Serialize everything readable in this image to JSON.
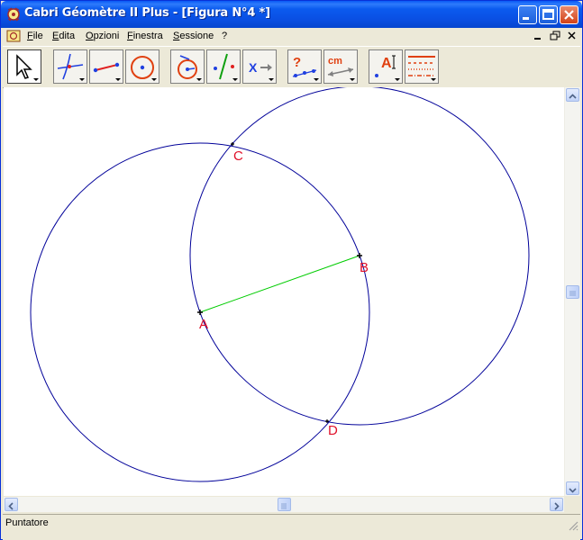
{
  "window": {
    "title": "Cabri Géomètre II Plus - [Figura N°4 *]"
  },
  "menubar": {
    "items": [
      "File",
      "Edita",
      "Opzioni",
      "Finestra",
      "Sessione",
      "?"
    ]
  },
  "toolbar": {
    "tools": [
      {
        "name": "pointer-tool",
        "active": true
      },
      {
        "name": "lines-tool"
      },
      {
        "name": "segment-tool"
      },
      {
        "name": "circle-tool"
      },
      {
        "name": "construction-tool"
      },
      {
        "name": "perpendicular-tool"
      },
      {
        "name": "transformation-tool"
      },
      {
        "name": "check-property-tool"
      },
      {
        "name": "measure-tool"
      },
      {
        "name": "text-label-tool"
      },
      {
        "name": "drawing-style-tool"
      }
    ],
    "measure_label": "cm",
    "label_tool_letter": "A",
    "property_tool_symbol": "?",
    "transform_tool_symbol": "X"
  },
  "figure": {
    "points": [
      {
        "label": "A"
      },
      {
        "label": "B"
      },
      {
        "label": "C"
      },
      {
        "label": "D"
      }
    ],
    "colors": {
      "circle": "#000099",
      "segment": "#00CC00",
      "label": "#E0102A"
    }
  },
  "statusbar": {
    "text": "Puntatore"
  }
}
